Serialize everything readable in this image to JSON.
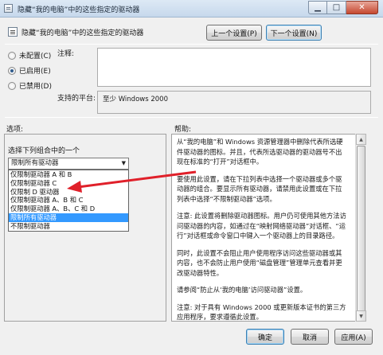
{
  "window": {
    "title": "隐藏“我的电脑”中的这些指定的驱动器",
    "controls": {
      "minimize": "▁",
      "maximize": "□",
      "close": "✕"
    }
  },
  "header": {
    "policy_title": "隐藏“我的电脑”中的这些指定的驱动器",
    "prev_button": "上一个设置(P)",
    "next_button": "下一个设置(N)"
  },
  "state": {
    "options": [
      {
        "label": "未配置(C)",
        "selected": false
      },
      {
        "label": "已启用(E)",
        "selected": true
      },
      {
        "label": "已禁用(D)",
        "selected": false
      }
    ]
  },
  "comment": {
    "label": "注释:",
    "value": ""
  },
  "supported": {
    "label": "支持的平台:",
    "value": "至少 Windows 2000"
  },
  "options_section": {
    "label": "选项:",
    "combo_label": "选择下列组合中的一个",
    "combo_value": "限制所有驱动器",
    "dropdown_items": [
      "仅限制驱动器 A 和 B",
      "仅限制驱动器 C",
      "仅限制 D 驱动器",
      "仅限制驱动器 A、B 和 C",
      "仅限制驱动器 A、B、C 和 D",
      "限制所有驱动器",
      "不限制驱动器"
    ],
    "selected_index": 5
  },
  "help_section": {
    "label": "帮助:",
    "paragraphs": [
      "从“我的电脑”和 Windows 资源管理器中删除代表所选硬件驱动器的图标。并且，代表所选驱动器的驱动器号不出现在标准的“打开”对话框中。",
      "要使用此设置，请在下拉列表中选择一个驱动器或多个驱动器的组合。要显示所有驱动器，请禁用此设置或在下拉列表中选择“不限制驱动器”选项。",
      "注意: 此设置将删除驱动器图标。用户仍可使用其他方法访问驱动器的内容，如通过在“映射网络驱动器”对话框、“运行”对话框或命令窗口中键入一个驱动器上的目录路径。",
      "同时，此设置不会阻止用户使用程序访问这些驱动器或其内容，也不会防止用户使用“磁盘管理”管理单元查看并更改驱动器特性。",
      "请参阅“防止从‘我的电脑’访问驱动器”设置。",
      "注意: 对于具有 Windows 2000 或更新版本证书的第三方应用程序，要求遵循此设置。"
    ]
  },
  "footer": {
    "ok": "确定",
    "cancel": "取消",
    "apply": "应用(A)"
  },
  "colors": {
    "selection": "#3399ff",
    "annotation_arrow": "#e0202a"
  }
}
